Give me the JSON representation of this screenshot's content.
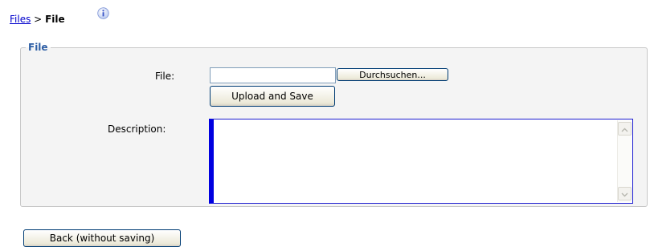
{
  "breadcrumb": {
    "parent_link": "Files",
    "separator": ">",
    "current": "File"
  },
  "info_icon": "info-icon",
  "form": {
    "legend": "File",
    "file_label": "File:",
    "file_value": "",
    "browse_label": "Durchsuchen...",
    "upload_label": "Upload and Save",
    "description_label": "Description:",
    "description_value": ""
  },
  "back_label": "Back (without saving)",
  "colors": {
    "link": "#0000cc",
    "legend": "#2d5ea5",
    "textarea_focus_border": "#0000e0",
    "fieldset_background": "#f4f4f4"
  }
}
